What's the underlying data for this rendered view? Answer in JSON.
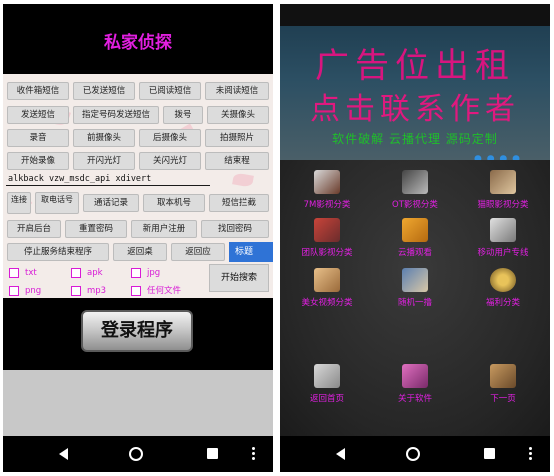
{
  "left": {
    "title": "私家侦探",
    "button_rows": [
      [
        "收件箱短信",
        "已发送短信",
        "已阅读短信",
        "未阅读短信"
      ],
      [
        "发送短信",
        "指定号码发送短信",
        "拨号",
        "关摄像头"
      ],
      [
        "录音",
        "前摄像头",
        "后摄像头",
        "拍摄照片"
      ],
      [
        "开始录像",
        "开闪光灯",
        "关闪光灯",
        "结束程"
      ]
    ],
    "command_input_value": "alkback vzw_msdc_api xdivert",
    "row6": [
      "连接",
      "取电话号",
      "通话记录",
      "取本机号",
      "短信拦截"
    ],
    "row7": [
      "开启后台",
      "重置密码",
      "新用户注册",
      "找回密码"
    ],
    "row8": [
      "停止服务结束程序",
      "返回桌",
      "返回应",
      "标题"
    ],
    "checkboxes": [
      "txt",
      "apk",
      "jpg",
      "png",
      "mp3",
      "任何文件"
    ],
    "search_button": "开始搜索",
    "login_button": "登录程序"
  },
  "right": {
    "ad_line1": "广告位出租",
    "ad_line2": "点击联系作者",
    "ad_line3": "软件破解 云播代理 源码定制",
    "ad_dots": "● ● ● ●",
    "grid": [
      {
        "label": "7M影视分类",
        "icon": "movie-reel-icon"
      },
      {
        "label": "OT影视分类",
        "icon": "projector-icon"
      },
      {
        "label": "猫眼影视分类",
        "icon": "cat-eye-icon"
      },
      {
        "label": "团队影视分类",
        "icon": "team-film-icon"
      },
      {
        "label": "云播观看",
        "icon": "film-clapper-icon"
      },
      {
        "label": "移动用户专线",
        "icon": "mobile-line-icon"
      },
      {
        "label": "美女视频分类",
        "icon": "video-icon"
      },
      {
        "label": "随机一撸",
        "icon": "random-icon"
      },
      {
        "label": "福利分类",
        "icon": "welfare-icon"
      },
      {
        "label": "返回首页",
        "icon": "home-icon"
      },
      {
        "label": "关于软件",
        "icon": "about-icon"
      },
      {
        "label": "下一页",
        "icon": "next-page-icon"
      }
    ]
  },
  "colors": {
    "magenta": "#e21fe0",
    "ad_pink": "#d8157f",
    "ad_green": "#1fbf2a",
    "tag_blue": "#2f73d6"
  }
}
